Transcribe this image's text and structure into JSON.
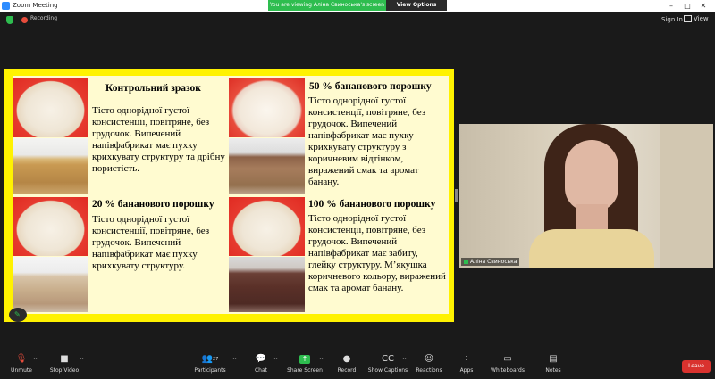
{
  "window": {
    "title": "Zoom Meeting",
    "controls": [
      "–",
      "□",
      "✕"
    ]
  },
  "banner": {
    "viewing": "You are viewing Аліна Свиноська's screen",
    "options": "View Options"
  },
  "topbar": {
    "recording": "Recording",
    "sign_in": "Sign In",
    "view": "View"
  },
  "slide": {
    "blocks": [
      {
        "title": "Контрольний зразок",
        "text": "Тісто однорідної густої консистенції, повітряне, без грудочок. Випечений напівфабрикат має пухку крихкувату структуру та дрібну пористість."
      },
      {
        "title": "50 % бананового порошку",
        "text": "Тісто однорідної густої консистенції, повітряне, без грудочок. Випечений напівфабрикат має пухку крихкувату структуру з коричневим відтінком, виражений смак та аромат банану."
      },
      {
        "title": "20 % бананового порошку",
        "text": "Тісто однорідної густої консистенції, повітряне, без грудочок. Випечений напівфабрикат має пухку крихкувату структуру."
      },
      {
        "title": "100 % бананового порошку",
        "text": "Тісто однорідної густої консистенції, повітряне, без грудочок. Випечений напівфабрикат має забиту, глейку структуру. М’якушка коричневого кольору, виражений смак та аромат банану."
      }
    ]
  },
  "video": {
    "participant_name": "Аліна Свиноська"
  },
  "toolbar": {
    "unmute": "Unmute",
    "stop_video": "Stop Video",
    "participants": "Participants",
    "participants_count": "27",
    "chat": "Chat",
    "share_screen": "Share Screen",
    "record": "Record",
    "show_captions": "Show Captions",
    "reactions": "Reactions",
    "apps": "Apps",
    "whiteboards": "Whiteboards",
    "notes": "Notes",
    "leave": "Leave"
  },
  "colors": {
    "accent_green": "#2ebd4f",
    "leave_red": "#d9322e",
    "slide_border": "#fff200"
  }
}
